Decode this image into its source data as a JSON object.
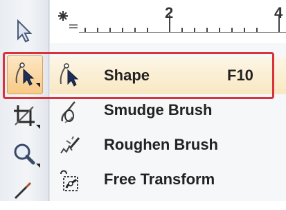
{
  "ruler": {
    "corner_icon": "ruler-origin-icon",
    "numbers": [
      "2",
      "4"
    ]
  },
  "toolbox": {
    "tools": [
      {
        "name": "pick-tool",
        "icon": "arrow-cursor-icon"
      },
      {
        "name": "shape-tool",
        "icon": "shape-node-icon",
        "active": true
      },
      {
        "name": "crop-tool",
        "icon": "crop-icon"
      },
      {
        "name": "zoom-tool",
        "icon": "magnifier-icon"
      },
      {
        "name": "curve-tool",
        "icon": "freehand-icon"
      }
    ]
  },
  "flyout": {
    "items": [
      {
        "label": "Shape",
        "shortcut": "F10",
        "icon": "shape-node-icon",
        "highlighted": true
      },
      {
        "label": "Smudge Brush",
        "shortcut": "",
        "icon": "smudge-brush-icon"
      },
      {
        "label": "Roughen Brush",
        "shortcut": "",
        "icon": "roughen-brush-icon"
      },
      {
        "label": "Free Transform",
        "shortcut": "",
        "icon": "free-transform-icon"
      }
    ]
  },
  "colors": {
    "highlight_border": "#d8323a",
    "active_tool": "#f7c985",
    "selected_item": "#f8e7c2"
  }
}
